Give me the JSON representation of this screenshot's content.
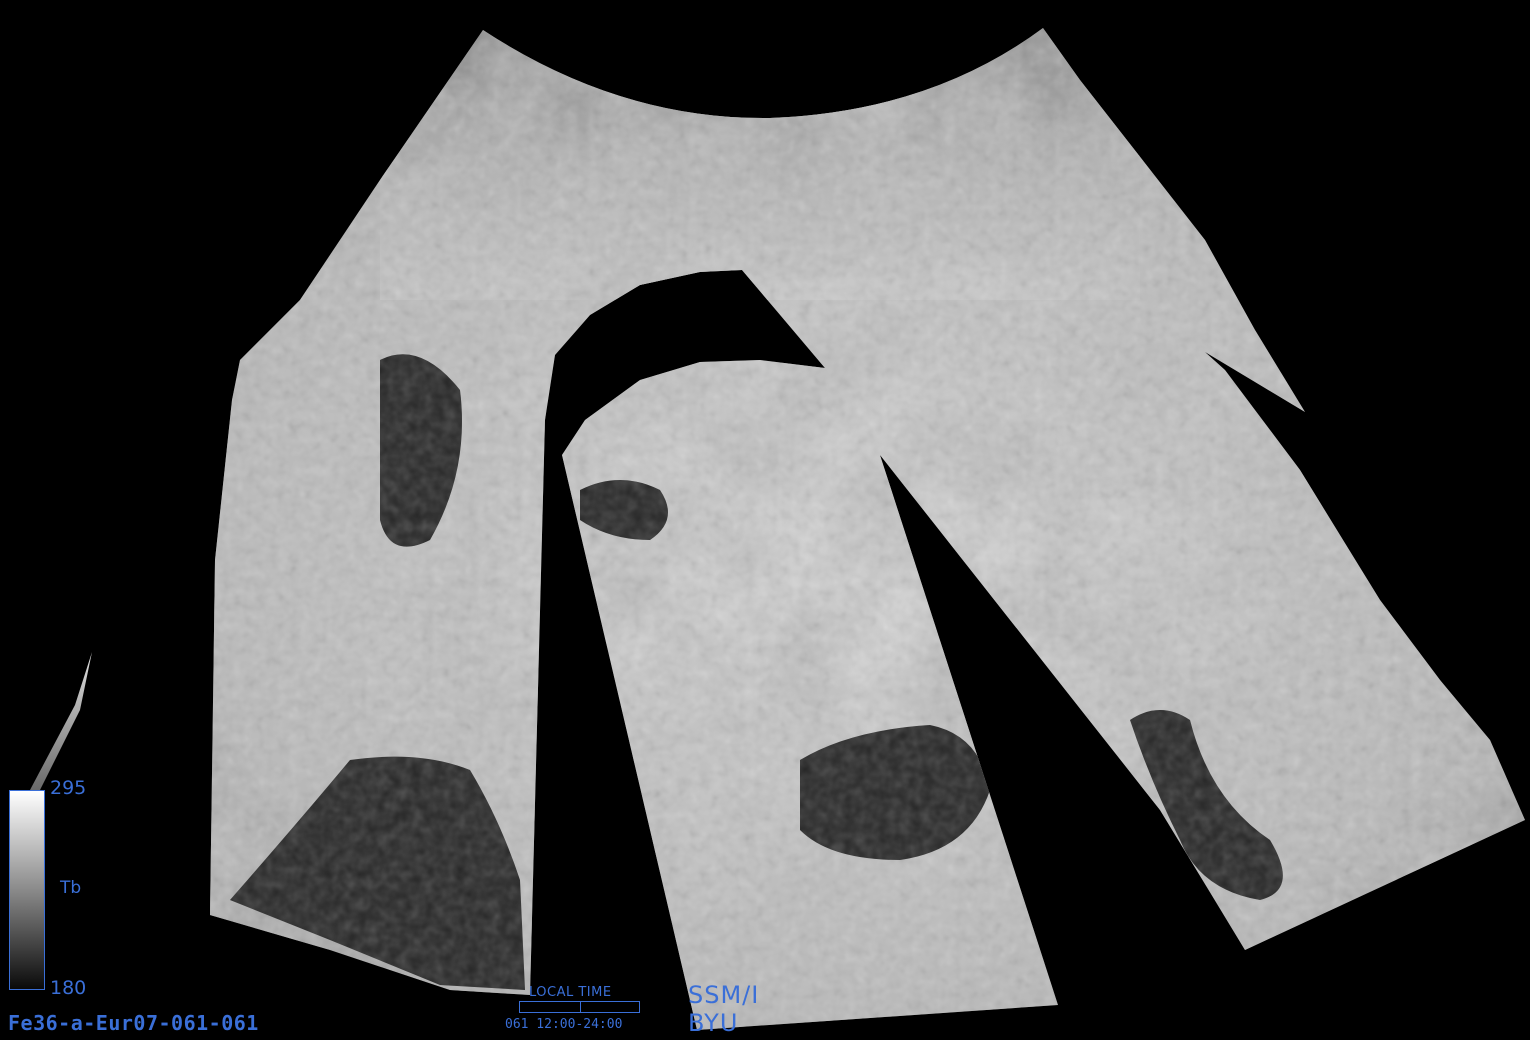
{
  "image_id_label": "Fe36-a-Eur07-061-061",
  "colorbar": {
    "max_label": "295",
    "min_label": "180",
    "variable_label": "Tb"
  },
  "local_time": {
    "title": "LOCAL TIME",
    "range_label": "061  12:00-24:00"
  },
  "credits": {
    "sensor": "SSM/I",
    "institution": "BYU"
  },
  "colors": {
    "background": "#000000",
    "label_blue": "#3a6fd8"
  }
}
